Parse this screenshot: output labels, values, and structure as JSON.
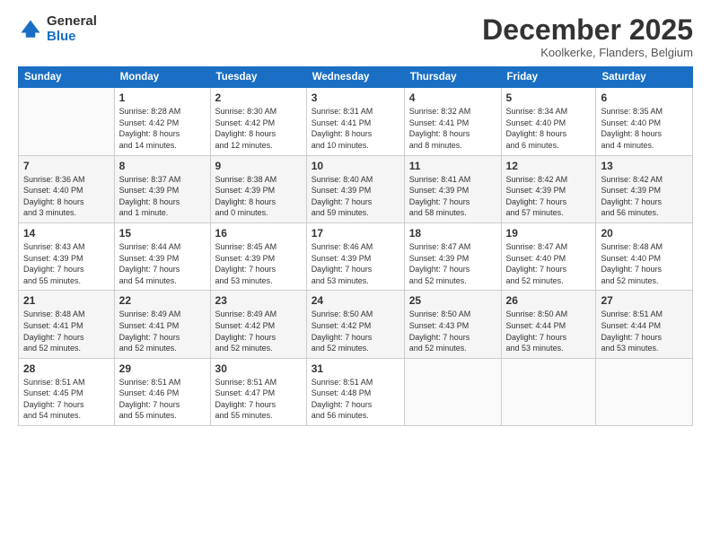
{
  "logo": {
    "general": "General",
    "blue": "Blue"
  },
  "header": {
    "month": "December 2025",
    "location": "Koolkerke, Flanders, Belgium"
  },
  "weekdays": [
    "Sunday",
    "Monday",
    "Tuesday",
    "Wednesday",
    "Thursday",
    "Friday",
    "Saturday"
  ],
  "weeks": [
    [
      {
        "day": "",
        "info": ""
      },
      {
        "day": "1",
        "info": "Sunrise: 8:28 AM\nSunset: 4:42 PM\nDaylight: 8 hours\nand 14 minutes."
      },
      {
        "day": "2",
        "info": "Sunrise: 8:30 AM\nSunset: 4:42 PM\nDaylight: 8 hours\nand 12 minutes."
      },
      {
        "day": "3",
        "info": "Sunrise: 8:31 AM\nSunset: 4:41 PM\nDaylight: 8 hours\nand 10 minutes."
      },
      {
        "day": "4",
        "info": "Sunrise: 8:32 AM\nSunset: 4:41 PM\nDaylight: 8 hours\nand 8 minutes."
      },
      {
        "day": "5",
        "info": "Sunrise: 8:34 AM\nSunset: 4:40 PM\nDaylight: 8 hours\nand 6 minutes."
      },
      {
        "day": "6",
        "info": "Sunrise: 8:35 AM\nSunset: 4:40 PM\nDaylight: 8 hours\nand 4 minutes."
      }
    ],
    [
      {
        "day": "7",
        "info": "Sunrise: 8:36 AM\nSunset: 4:40 PM\nDaylight: 8 hours\nand 3 minutes."
      },
      {
        "day": "8",
        "info": "Sunrise: 8:37 AM\nSunset: 4:39 PM\nDaylight: 8 hours\nand 1 minute."
      },
      {
        "day": "9",
        "info": "Sunrise: 8:38 AM\nSunset: 4:39 PM\nDaylight: 8 hours\nand 0 minutes."
      },
      {
        "day": "10",
        "info": "Sunrise: 8:40 AM\nSunset: 4:39 PM\nDaylight: 7 hours\nand 59 minutes."
      },
      {
        "day": "11",
        "info": "Sunrise: 8:41 AM\nSunset: 4:39 PM\nDaylight: 7 hours\nand 58 minutes."
      },
      {
        "day": "12",
        "info": "Sunrise: 8:42 AM\nSunset: 4:39 PM\nDaylight: 7 hours\nand 57 minutes."
      },
      {
        "day": "13",
        "info": "Sunrise: 8:42 AM\nSunset: 4:39 PM\nDaylight: 7 hours\nand 56 minutes."
      }
    ],
    [
      {
        "day": "14",
        "info": "Sunrise: 8:43 AM\nSunset: 4:39 PM\nDaylight: 7 hours\nand 55 minutes."
      },
      {
        "day": "15",
        "info": "Sunrise: 8:44 AM\nSunset: 4:39 PM\nDaylight: 7 hours\nand 54 minutes."
      },
      {
        "day": "16",
        "info": "Sunrise: 8:45 AM\nSunset: 4:39 PM\nDaylight: 7 hours\nand 53 minutes."
      },
      {
        "day": "17",
        "info": "Sunrise: 8:46 AM\nSunset: 4:39 PM\nDaylight: 7 hours\nand 53 minutes."
      },
      {
        "day": "18",
        "info": "Sunrise: 8:47 AM\nSunset: 4:39 PM\nDaylight: 7 hours\nand 52 minutes."
      },
      {
        "day": "19",
        "info": "Sunrise: 8:47 AM\nSunset: 4:40 PM\nDaylight: 7 hours\nand 52 minutes."
      },
      {
        "day": "20",
        "info": "Sunrise: 8:48 AM\nSunset: 4:40 PM\nDaylight: 7 hours\nand 52 minutes."
      }
    ],
    [
      {
        "day": "21",
        "info": "Sunrise: 8:48 AM\nSunset: 4:41 PM\nDaylight: 7 hours\nand 52 minutes."
      },
      {
        "day": "22",
        "info": "Sunrise: 8:49 AM\nSunset: 4:41 PM\nDaylight: 7 hours\nand 52 minutes."
      },
      {
        "day": "23",
        "info": "Sunrise: 8:49 AM\nSunset: 4:42 PM\nDaylight: 7 hours\nand 52 minutes."
      },
      {
        "day": "24",
        "info": "Sunrise: 8:50 AM\nSunset: 4:42 PM\nDaylight: 7 hours\nand 52 minutes."
      },
      {
        "day": "25",
        "info": "Sunrise: 8:50 AM\nSunset: 4:43 PM\nDaylight: 7 hours\nand 52 minutes."
      },
      {
        "day": "26",
        "info": "Sunrise: 8:50 AM\nSunset: 4:44 PM\nDaylight: 7 hours\nand 53 minutes."
      },
      {
        "day": "27",
        "info": "Sunrise: 8:51 AM\nSunset: 4:44 PM\nDaylight: 7 hours\nand 53 minutes."
      }
    ],
    [
      {
        "day": "28",
        "info": "Sunrise: 8:51 AM\nSunset: 4:45 PM\nDaylight: 7 hours\nand 54 minutes."
      },
      {
        "day": "29",
        "info": "Sunrise: 8:51 AM\nSunset: 4:46 PM\nDaylight: 7 hours\nand 55 minutes."
      },
      {
        "day": "30",
        "info": "Sunrise: 8:51 AM\nSunset: 4:47 PM\nDaylight: 7 hours\nand 55 minutes."
      },
      {
        "day": "31",
        "info": "Sunrise: 8:51 AM\nSunset: 4:48 PM\nDaylight: 7 hours\nand 56 minutes."
      },
      {
        "day": "",
        "info": ""
      },
      {
        "day": "",
        "info": ""
      },
      {
        "day": "",
        "info": ""
      }
    ]
  ]
}
